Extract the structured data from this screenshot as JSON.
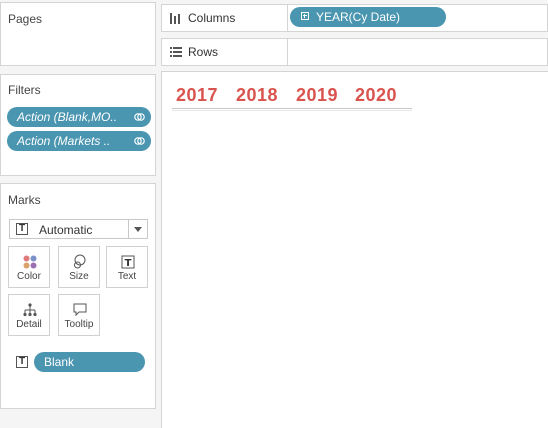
{
  "pages": {
    "title": "Pages"
  },
  "filters": {
    "title": "Filters",
    "items": [
      {
        "label": "Action (Blank,MO.."
      },
      {
        "label": "Action (Markets .."
      }
    ]
  },
  "marks": {
    "title": "Marks",
    "mark_type": "Automatic",
    "cards": {
      "color": "Color",
      "size": "Size",
      "text": "Text",
      "detail": "Detail",
      "tooltip": "Tooltip"
    },
    "text_pill": "Blank"
  },
  "shelves": {
    "columns_label": "Columns",
    "columns_pill": "YEAR(Cy Date)",
    "rows_label": "Rows"
  },
  "view": {
    "years": [
      "2017",
      "2018",
      "2019",
      "2020"
    ],
    "year_color": "#d9534f"
  },
  "colors": {
    "pill": "#4a95b0",
    "panel_border": "#d4d4d4"
  }
}
